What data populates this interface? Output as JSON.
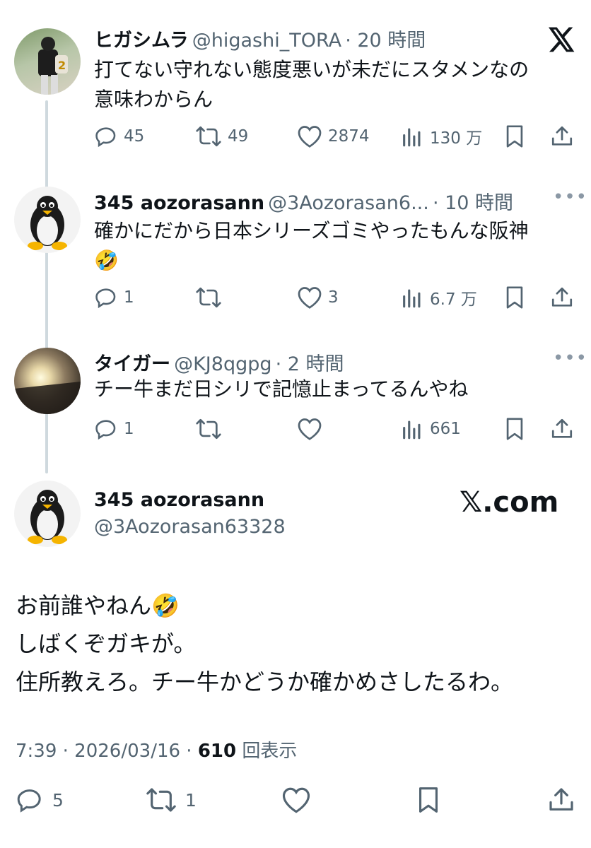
{
  "brand": {
    "x_logo": "x-logo",
    "watermark": "𝕏.com"
  },
  "tweets": [
    {
      "name": "ヒガシムラ",
      "handle": "@higashi_TORA",
      "time": "· 20 時間",
      "text_lines": [
        "打てない守れない態度悪いが未だにスタメンなの",
        "意味わからん"
      ],
      "replies": "45",
      "retweets": "49",
      "likes": "2874",
      "views": "130 万"
    },
    {
      "name": "345 aozorasann",
      "handle": "@3Aozorasan6...",
      "time": "· 10 時間",
      "text_lines": [
        "確かにだから日本シリーズゴミやったもんな阪神",
        "🤣"
      ],
      "replies": "1",
      "retweets": "",
      "likes": "3",
      "views": "6.7 万"
    },
    {
      "name": "タイガー",
      "handle": "@KJ8qgpg",
      "time": "· 2 時間",
      "text_lines": [
        "チー牛まだ日シリで記憶止まってるんやね"
      ],
      "replies": "1",
      "retweets": "",
      "likes": "",
      "views": "661"
    }
  ],
  "main": {
    "name": "345 aozorasann",
    "handle": "@3Aozorasan63328",
    "text_lines": [
      "お前誰やねん🤣",
      "しばくぞガキが。",
      "住所教えろ。チー牛かどうか確かめさしたるわ。"
    ],
    "time": "7:39 · 2026/03/16 · ",
    "views_count": "610",
    "views_label": " 回表示",
    "replies": "5",
    "retweets": "1"
  },
  "colors": {
    "text": "#0f1419",
    "secondary": "#536471",
    "line": "#cfd9de"
  }
}
